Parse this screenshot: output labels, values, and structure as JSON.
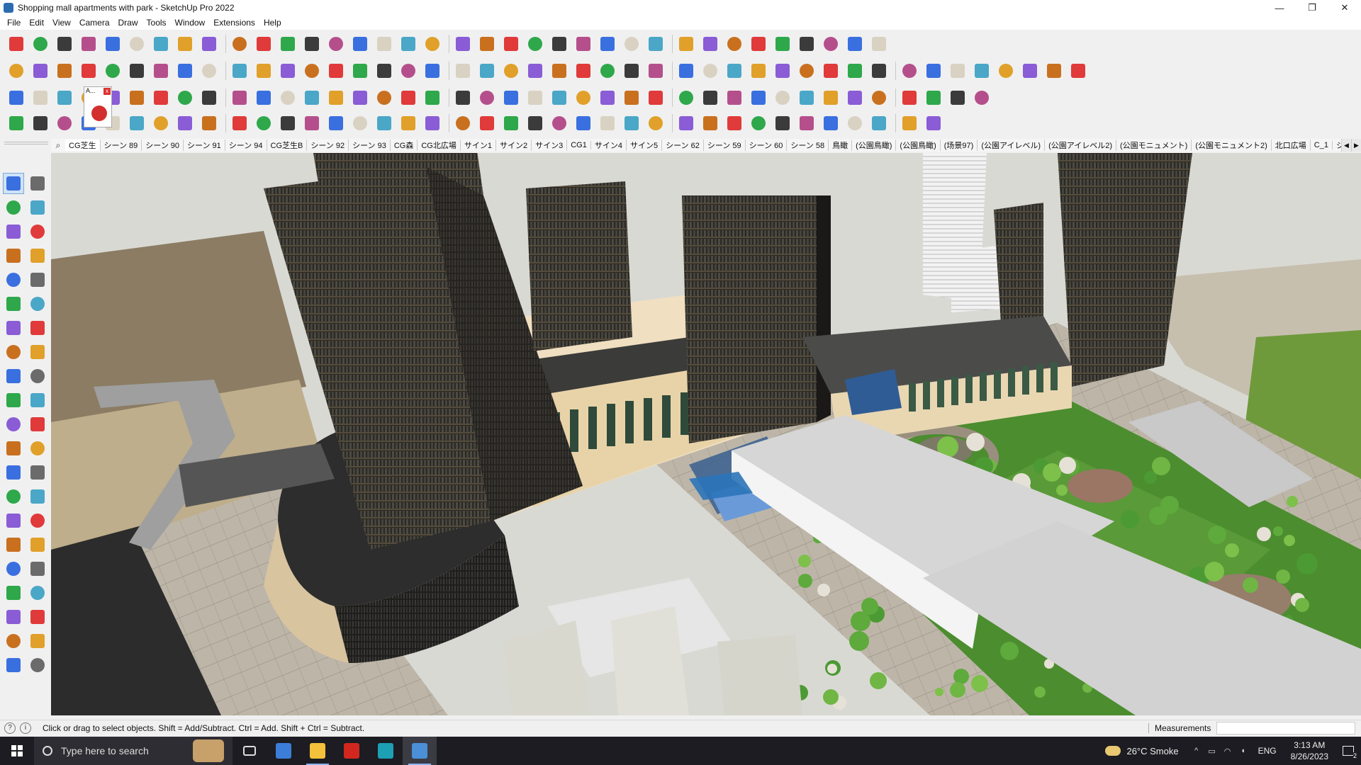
{
  "window": {
    "title": "Shopping mall apartments with park - SketchUp Pro 2022",
    "controls": {
      "minimize": "—",
      "maximize": "❐",
      "close": "✕"
    }
  },
  "menu": [
    "File",
    "Edit",
    "View",
    "Camera",
    "Draw",
    "Tools",
    "Window",
    "Extensions",
    "Help"
  ],
  "scenes": {
    "search_glyph": "⌕",
    "tabs": [
      "CG芝生",
      "シーン 89",
      "シーン 90",
      "シーン 91",
      "シーン 94",
      "CG芝生B",
      "シーン 92",
      "シーン 93",
      "CG森",
      "CG北広場",
      "サイン1",
      "サイン2",
      "サイン3",
      "CG1",
      "サイン4",
      "サイン5",
      "シーン 62",
      "シーン 59",
      "シーン 60",
      "シーン 58",
      "鳥瞰",
      "(公園鳥瞰)",
      "(公園鳥瞰)",
      "(场景97)",
      "(公園アイレベル)",
      "(公園アイレベル2)",
      "(公園モニュメント)",
      "(公園モニュメント2)",
      "北口広場",
      "C_1",
      "シ"
    ],
    "active_index": 0,
    "nav": [
      "◀",
      "▶"
    ]
  },
  "flyout": {
    "label": "A...",
    "close": "x",
    "icon": "ruby-icon"
  },
  "status": {
    "hint": "Click or drag to select objects. Shift = Add/Subtract. Ctrl = Add. Shift + Ctrl = Subtract.",
    "measurements_label": "Measurements",
    "measurements_value": "",
    "left_icons": [
      "?",
      "i"
    ]
  },
  "taskbar": {
    "search_placeholder": "Type here to search",
    "apps": [
      "task-view-icon",
      "calculator-icon",
      "file-explorer-icon",
      "acrobat-icon",
      "3dsmax-icon",
      "sketchup-icon"
    ],
    "weather": "26°C  Smoke",
    "tray_icons": [
      "^",
      "▭",
      "◠",
      "◖"
    ],
    "language": "ENG",
    "time": "3:13 AM",
    "date": "8/26/2023",
    "notifications": "2"
  },
  "colors": {
    "accent": "#2b6cb0",
    "sky": "#d9d9d4",
    "tower_dark": "#2a2722",
    "grass": "#4c8d2f",
    "plaza": "#b9b3a6"
  }
}
